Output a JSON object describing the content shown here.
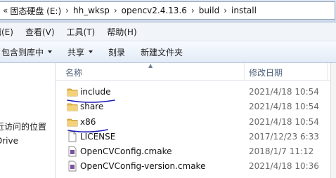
{
  "address": {
    "crumbs": [
      "固态硬盘 (E:)",
      "hh_wksp",
      "opencv2.4.13.6",
      "build",
      "install"
    ]
  },
  "menu": {
    "items": [
      "编辑(E)",
      "查看(V)",
      "工具(T)",
      "帮助(H)"
    ]
  },
  "toolbar": {
    "include_library": "包含到库中",
    "share": "共享",
    "burn": "刻录",
    "new_folder": "新建文件夹"
  },
  "nav": {
    "recent_places": "最近访问的位置",
    "drive": "Drive"
  },
  "columns": {
    "name": "名称",
    "date": "修改日期",
    "type": "类"
  },
  "files": [
    {
      "name": "include",
      "date": "2021/4/18 10:54",
      "icon": "folder-icon",
      "underlined": true
    },
    {
      "name": "share",
      "date": "2021/4/18 10:54",
      "icon": "folder-icon",
      "underlined": false
    },
    {
      "name": "x86",
      "date": "2021/4/18 10:54",
      "icon": "folder-icon",
      "underlined": true
    },
    {
      "name": "LICENSE",
      "date": "2017/12/23 6:33",
      "icon": "file-icon",
      "underlined": false
    },
    {
      "name": "OpenCVConfig.cmake",
      "date": "2018/1/7 11:12",
      "icon": "cmake-file-icon",
      "underlined": false
    },
    {
      "name": "OpenCVConfig-version.cmake",
      "date": "2021/4/18 10:36",
      "icon": "cmake-file-icon",
      "underlined": false
    }
  ],
  "annotation_color": "#1a1ab8"
}
